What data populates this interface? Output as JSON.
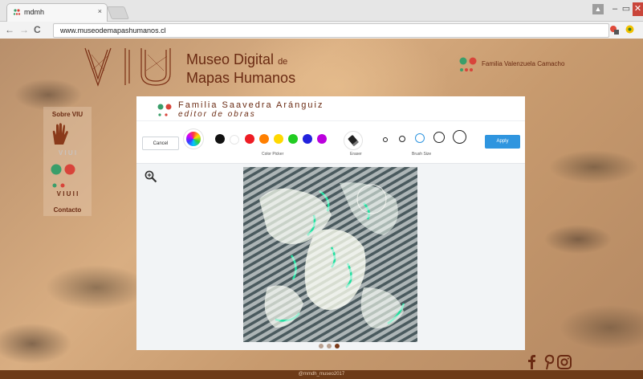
{
  "browser": {
    "tab_title": "mdmh",
    "tab_close": "×",
    "url": "www.museodemapashumanos.cl",
    "nav": {
      "back": "←",
      "forward": "→",
      "reload": "C"
    },
    "window_buttons": {
      "user": "▲",
      "minimize": "–",
      "maximize": "▭",
      "close": "✕"
    }
  },
  "site": {
    "title_line1": "Museo Digital",
    "title_de": "de",
    "title_line2": "Mapas Humanos",
    "family_link": "Familia Valenzuela Camacho",
    "footer": "@mmdh_museo2017"
  },
  "sidenav": {
    "items": [
      {
        "label": "Sobre VIU"
      },
      {
        "label": "V I U  I"
      },
      {
        "label": "V I U  I I"
      },
      {
        "label": "Contacto"
      }
    ]
  },
  "editor": {
    "title": "Familia Saavedra Aránguiz",
    "subtitle": "editor de obras",
    "cancel_label": "Cancel",
    "color_picker_label": "Color Picker",
    "eraser_label": "Eraser",
    "brush_size_label": "Brush Size",
    "apply_label": "Apply",
    "colors": [
      "#111111",
      "#ffffff",
      "#ee1c24",
      "#ff7f00",
      "#ffd800",
      "#22cc22",
      "#2222dd",
      "#bb00dd"
    ],
    "brush_sizes": [
      "xs",
      "s",
      "m",
      "l",
      "xl"
    ],
    "selected_brush": 2,
    "image_pages": 3,
    "current_page": 2
  },
  "colors": {
    "brand_brown": "#6a2a12",
    "accent_blue": "#2f95df",
    "dot_green": "#3a9e6a",
    "dot_red": "#d8443a"
  }
}
